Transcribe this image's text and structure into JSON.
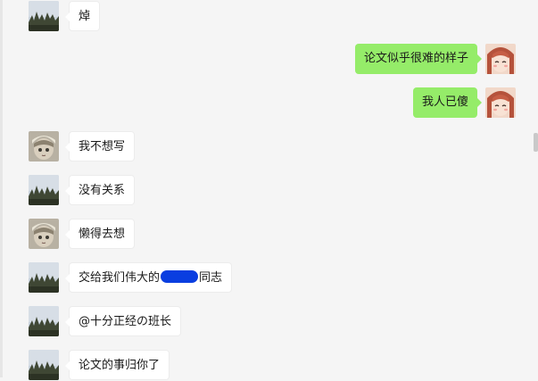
{
  "colors": {
    "background": "#f5f5f5",
    "incoming_bubble": "#ffffff",
    "outgoing_bubble": "#95ec69",
    "redaction": "#0a3ee0"
  },
  "messages": [
    {
      "direction": "incoming",
      "avatar": "landscape-trees-avatar",
      "text": "焯"
    },
    {
      "direction": "outgoing",
      "avatar": "cartoon-girl-avatar",
      "text": "论文似乎很难的样子"
    },
    {
      "direction": "outgoing",
      "avatar": "cartoon-girl-avatar",
      "text": "我人已傻"
    },
    {
      "direction": "incoming",
      "avatar": "anime-character-avatar",
      "text": "我不想写"
    },
    {
      "direction": "incoming",
      "avatar": "landscape-trees-avatar",
      "text": "没有关系"
    },
    {
      "direction": "incoming",
      "avatar": "anime-character-avatar",
      "text": "懒得去想"
    },
    {
      "direction": "incoming",
      "avatar": "landscape-trees-avatar",
      "text_before": "交给我们伟大的",
      "text_after": "同志"
    },
    {
      "direction": "incoming",
      "avatar": "landscape-trees-avatar",
      "text": "@十分正经の班长"
    },
    {
      "direction": "incoming",
      "avatar": "landscape-trees-avatar",
      "text": "论文的事归你了"
    }
  ]
}
